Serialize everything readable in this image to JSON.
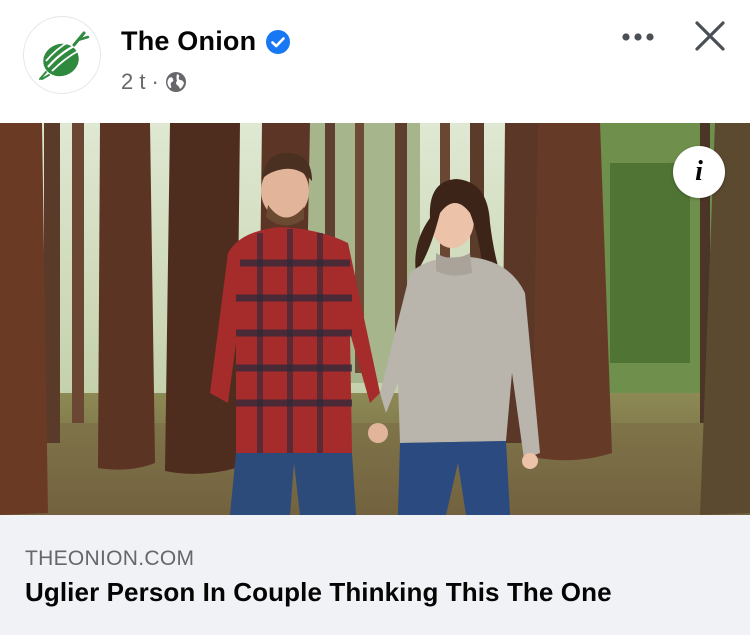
{
  "post": {
    "page_name": "The Onion",
    "time": "2 t",
    "separator": "·",
    "verified_icon": "verified-badge-icon",
    "privacy_icon": "globe-icon",
    "more_icon": "more-horizontal-icon",
    "close_icon": "close-icon"
  },
  "media": {
    "info_label": "i",
    "info_icon": "info-icon"
  },
  "link": {
    "domain": "THEONION.COM",
    "headline": "Uglier Person In Couple Thinking This The One"
  },
  "colors": {
    "brand_green": "#2f8a3f",
    "verified_blue": "#1877f2",
    "secondary_text": "#65676b",
    "link_bar_bg": "#f0f2f5"
  }
}
